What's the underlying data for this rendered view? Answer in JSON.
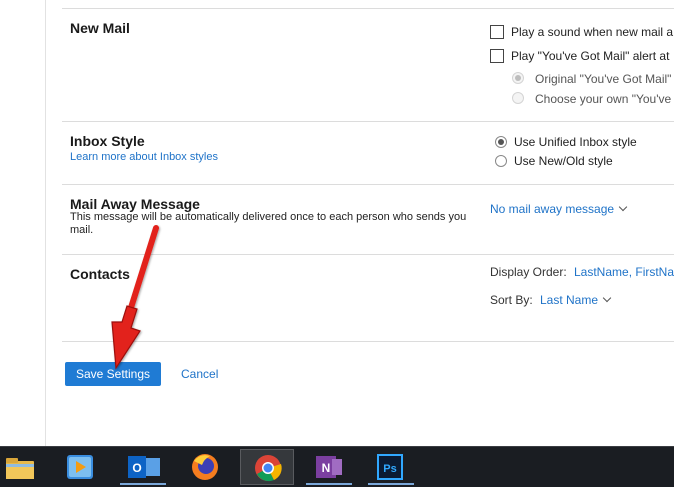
{
  "settings": {
    "new_mail": {
      "title": "New Mail",
      "play_sound": "Play a sound when new mail a",
      "youve_got_mail_alert": "Play \"You've Got Mail\" alert at",
      "original_option": "Original \"You've Got Mail\"",
      "choose_own_option": "Choose your own \"You've"
    },
    "inbox_style": {
      "title": "Inbox Style",
      "learn_more": "Learn more about Inbox styles",
      "unified": "Use Unified Inbox style",
      "new_old": "Use New/Old style"
    },
    "mail_away": {
      "title": "Mail Away Message",
      "description": "This message will be automatically delivered once to each person who sends you mail.",
      "dropdown": "No mail away message"
    },
    "contacts": {
      "title": "Contacts",
      "display_order_label": "Display Order:",
      "display_order_value": "LastName, FirstNa",
      "sort_by_label": "Sort By:",
      "sort_by_value": "Last Name"
    }
  },
  "actions": {
    "save": "Save Settings",
    "cancel": "Cancel"
  },
  "taskbar": {
    "apps": [
      "file-explorer-icon",
      "media-player-icon",
      "outlook-icon",
      "firefox-icon",
      "chrome-icon",
      "onenote-icon",
      "photoshop-icon"
    ]
  },
  "colors": {
    "link": "#1f73c8",
    "save_button": "#1f7bd4",
    "taskbar": "#1a1d22",
    "annotation_arrow": "#e2231a"
  }
}
